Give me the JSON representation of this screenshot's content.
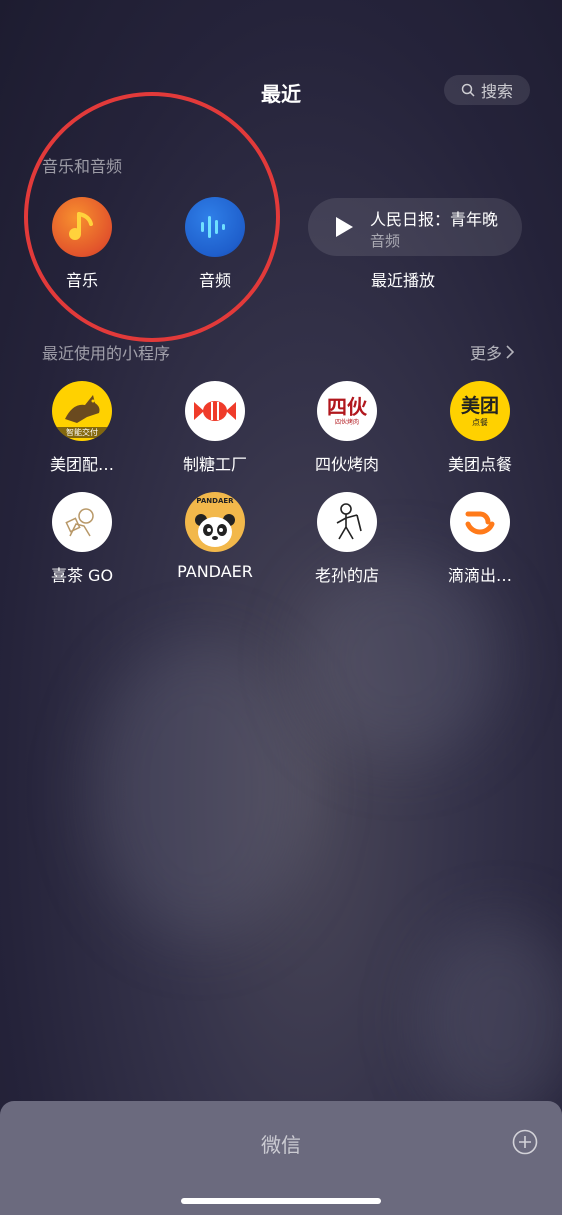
{
  "header": {
    "title": "最近",
    "search_label": "搜索"
  },
  "music_section": {
    "label": "音乐和音频",
    "items": [
      {
        "label": "音乐",
        "icon": "music-note-icon"
      },
      {
        "label": "音频",
        "icon": "audio-wave-icon"
      }
    ],
    "recent_card": {
      "title": "人民日报：青年晚",
      "subtitle": "音频",
      "caption": "最近播放"
    }
  },
  "mini_programs": {
    "label": "最近使用的小程序",
    "more_label": "更多",
    "items": [
      {
        "label": "美团配…",
        "icon": "kangaroo-logo-icon",
        "badge": "智能交付"
      },
      {
        "label": "制糖工厂",
        "icon": "candy-icon"
      },
      {
        "label": "四伙烤肉",
        "icon": "sihuo-logo-icon",
        "logo_text": "四伙",
        "logo_sub": "四伙烤肉"
      },
      {
        "label": "美团点餐",
        "icon": "meituan-logo-icon",
        "logo_text": "美团",
        "logo_sub": "点餐"
      },
      {
        "label": "喜茶 GO",
        "icon": "heytea-logo-icon"
      },
      {
        "label": "PANDAER",
        "icon": "panda-logo-icon",
        "logo_text": "PANDAER"
      },
      {
        "label": "老孙的店",
        "icon": "stickman-logo-icon"
      },
      {
        "label": "滴滴出…",
        "icon": "didi-logo-icon"
      }
    ]
  },
  "bottom_bar": {
    "title": "微信"
  },
  "colors": {
    "highlight": "#e23a3a",
    "meituan_yellow": "#ffd100",
    "didi_orange": "#ff7a1a"
  }
}
